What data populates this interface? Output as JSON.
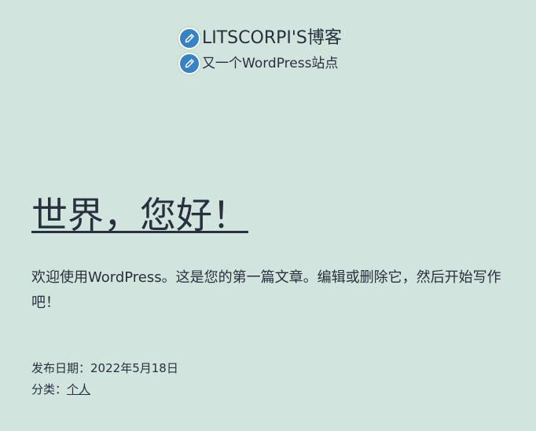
{
  "site": {
    "title": "LITSCORPI'S博客",
    "tagline": "又一个WordPress站点",
    "edit_icon": "pencil-icon"
  },
  "post": {
    "title": "世界，您好！",
    "content": "欢迎使用WordPress。这是您的第一篇文章。编辑或删除它，然后开始写作吧！"
  },
  "footer": {
    "date_label": "发布日期：",
    "date_value": "2022年5月18日",
    "category_label": "分类：",
    "category_value": "个人"
  },
  "colors": {
    "background": "#d1e4dd",
    "text": "#28303d",
    "edit_icon_bg": "#3582c4"
  }
}
